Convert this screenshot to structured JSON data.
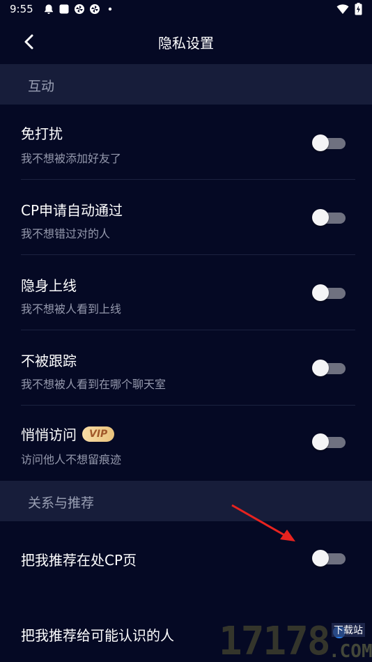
{
  "status_bar": {
    "time": "9:55",
    "left_icons": [
      "bell-icon",
      "square-icon",
      "pinwheel-icon",
      "pinwheel-icon",
      "dot-icon"
    ],
    "right_icons": [
      "wifi-icon",
      "battery-icon"
    ]
  },
  "header": {
    "title": "隐私设置",
    "back_icon": "chevron-left-icon"
  },
  "sections": [
    {
      "title": "互动",
      "rows": [
        {
          "title": "免打扰",
          "subtitle": "我不想被添加好友了",
          "enabled": false
        },
        {
          "title": "CP申请自动通过",
          "subtitle": "我不想错过对的人",
          "enabled": false
        },
        {
          "title": "隐身上线",
          "subtitle": "我不想被人看到上线",
          "enabled": false
        },
        {
          "title": "不被跟踪",
          "subtitle": "我不想被人看到在哪个聊天室",
          "enabled": false
        },
        {
          "title": "悄悄访问",
          "badge": "VIP",
          "subtitle": "访问他人不想留痕迹",
          "enabled": false
        }
      ]
    },
    {
      "title": "关系与推荐",
      "rows": [
        {
          "title": "把我推荐在处CP页",
          "enabled": false
        },
        {
          "title": "把我推荐给可能认识的人",
          "enabled": false
        }
      ]
    }
  ],
  "annotation": {
    "arrow_color": "#e8231f"
  },
  "watermark": {
    "number": "17178",
    "domain": ".COM",
    "label": "下载站"
  },
  "colors": {
    "background": "#050924",
    "section_bg": "#171d3a",
    "toggle_track": "#6f7180",
    "toggle_thumb": "#f4f4f6",
    "vip_badge": "#f1cf91"
  }
}
